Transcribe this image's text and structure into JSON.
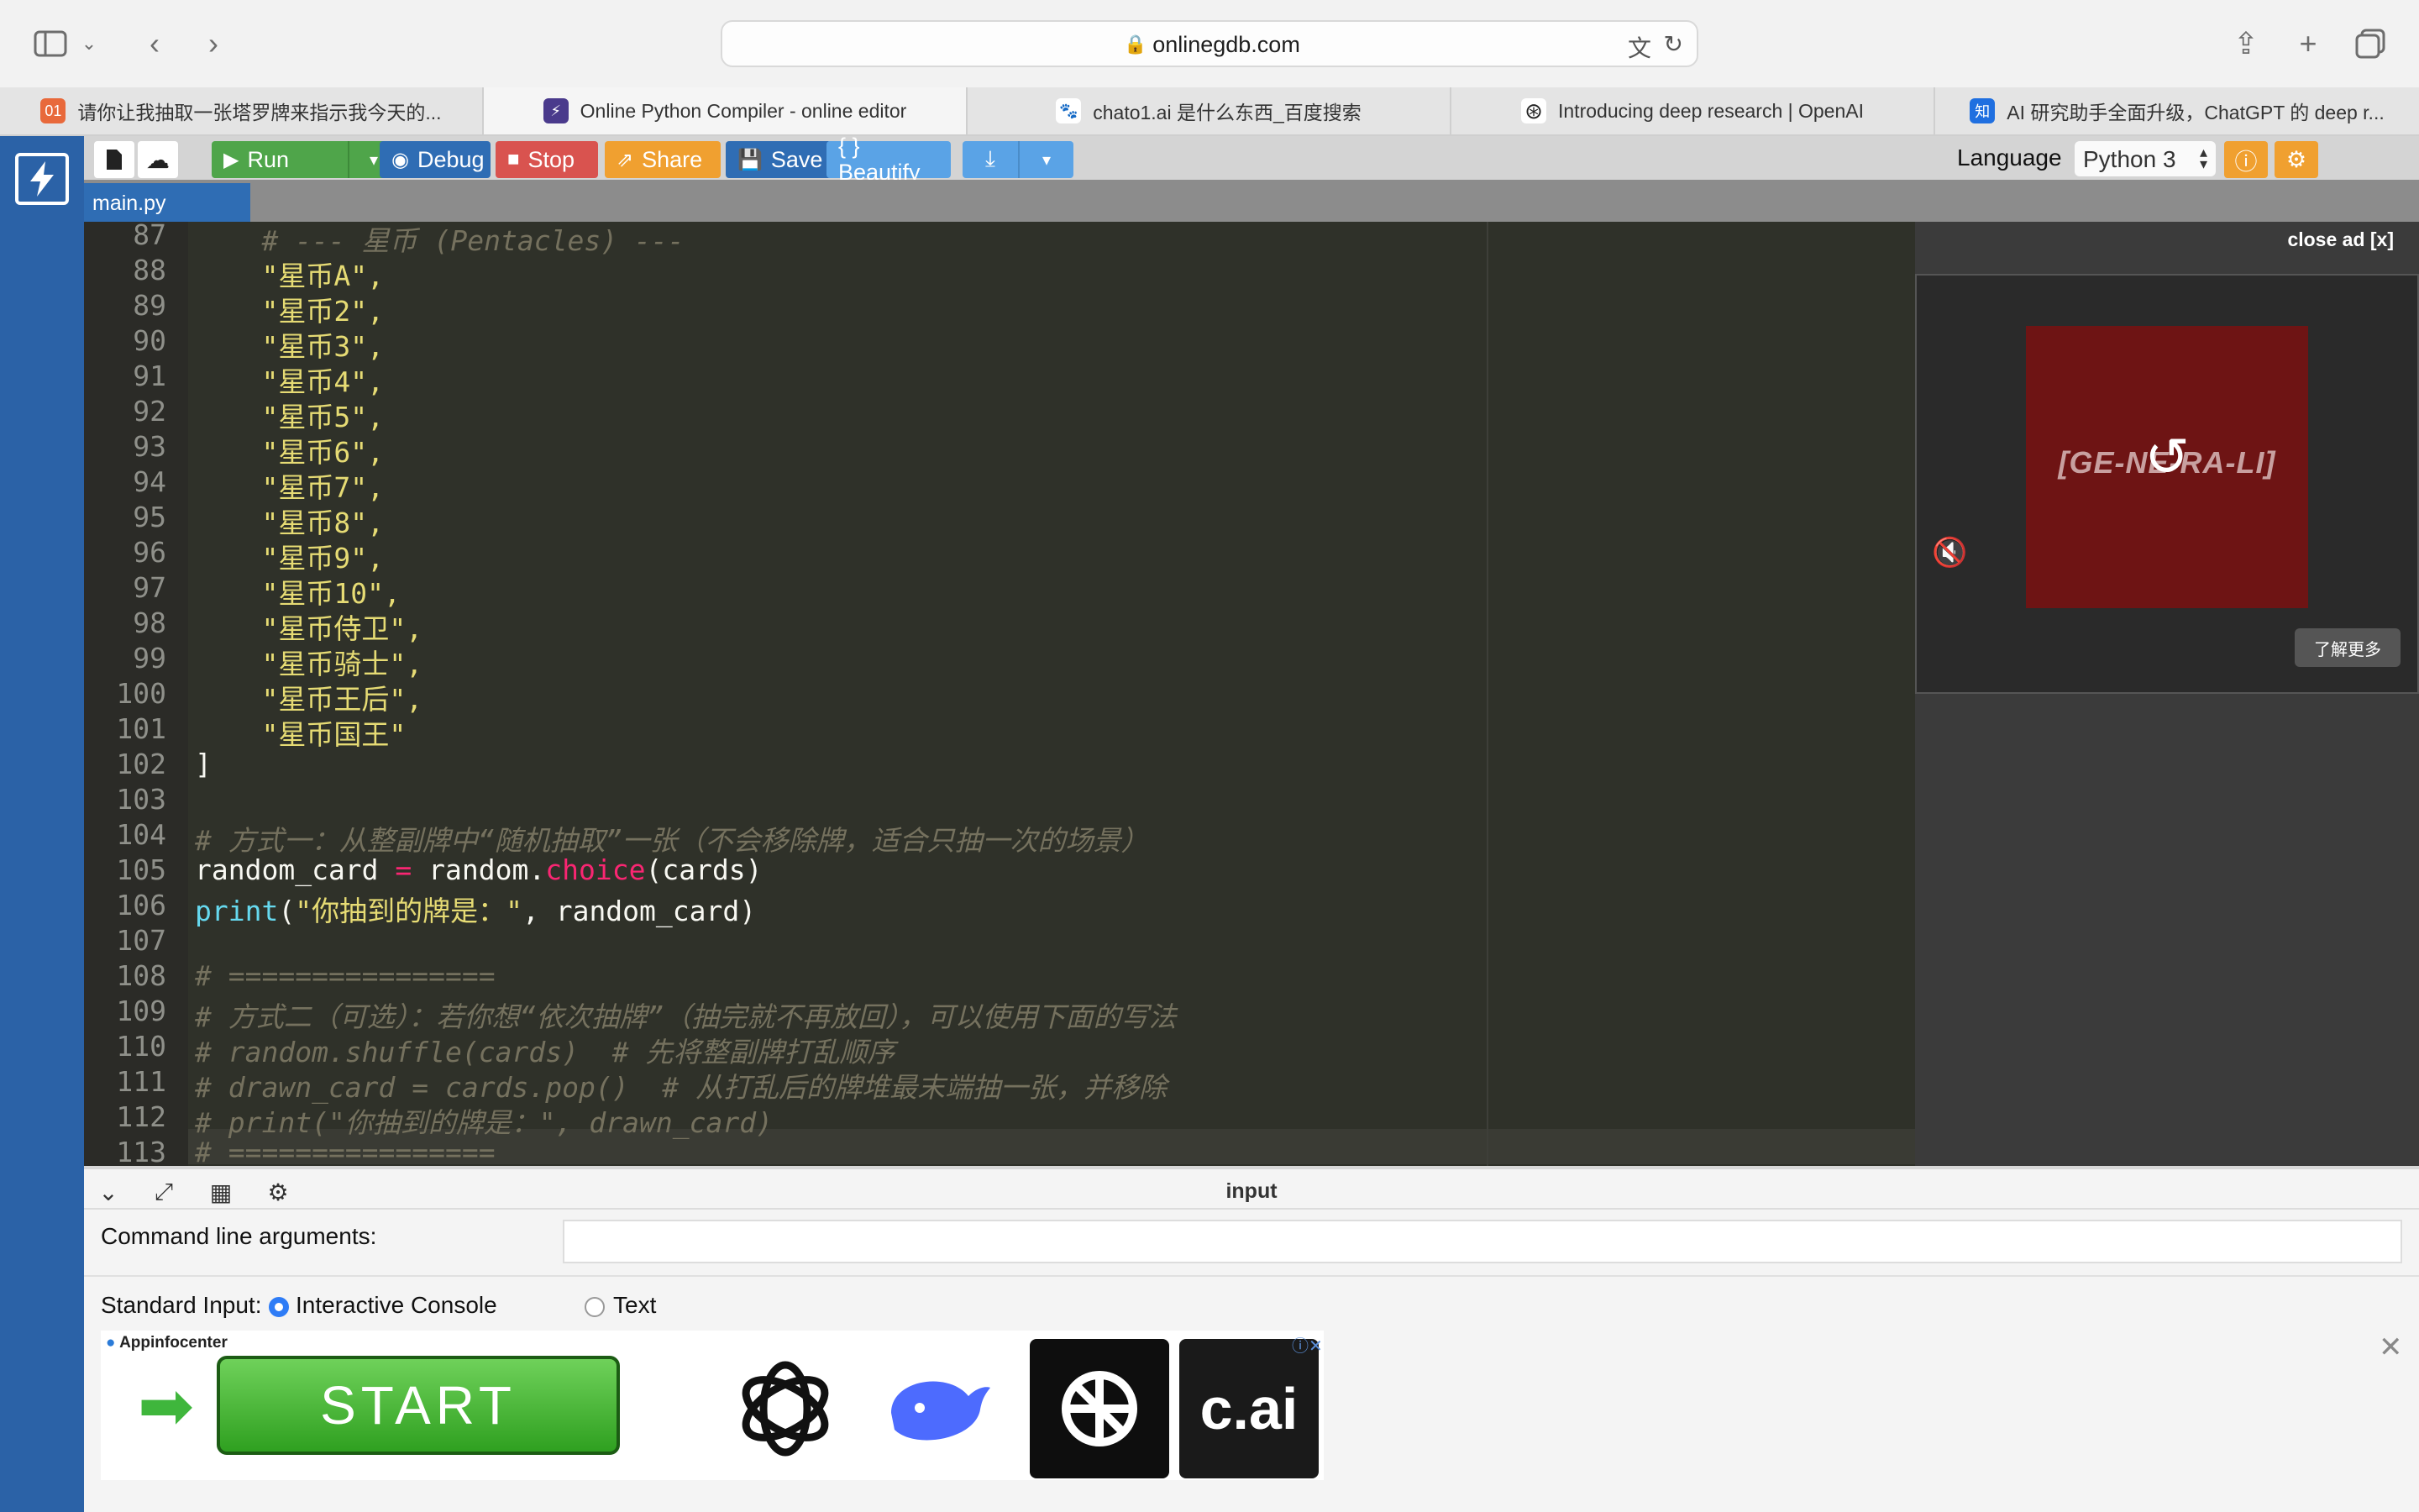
{
  "browser": {
    "address": "onlinegdb.com",
    "tabs": [
      {
        "label": "请你让我抽取一张塔罗牌来指示我今天的...",
        "favicon_text": "01",
        "favicon_color": "#e8693b"
      },
      {
        "label": "Online Python Compiler - online editor",
        "favicon_text": "⚡",
        "favicon_color": "#4a3a8c"
      },
      {
        "label": "chato1.ai 是什么东西_百度搜索",
        "favicon_text": "🐾",
        "favicon_color": "#ffffff"
      },
      {
        "label": "Introducing deep research | OpenAI",
        "favicon_text": "⊛",
        "favicon_color": "#ffffff"
      },
      {
        "label": "AI 研究助手全面升级，ChatGPT 的 deep r...",
        "favicon_text": "知",
        "favicon_color": "#1f6fe0"
      }
    ]
  },
  "toolbar": {
    "run": "Run",
    "debug": "Debug",
    "stop": "Stop",
    "share": "Share",
    "save": "Save",
    "beautify": "{ } Beautify",
    "language_label": "Language",
    "language_value": "Python 3"
  },
  "file_tab": "main.py",
  "editor": {
    "line_numbers": [
      "87",
      "88",
      "89",
      "90",
      "91",
      "92",
      "93",
      "94",
      "95",
      "96",
      "97",
      "98",
      "99",
      "100",
      "101",
      "102",
      "103",
      "104",
      "105",
      "106",
      "107",
      "108",
      "109",
      "110",
      "111",
      "112",
      "113"
    ],
    "lines": {
      "l87": "    # --- 星币 (Pentacles) ---",
      "l88": "    \"星币A\",",
      "l89": "    \"星币2\",",
      "l90": "    \"星币3\",",
      "l91": "    \"星币4\",",
      "l92": "    \"星币5\",",
      "l93": "    \"星币6\",",
      "l94": "    \"星币7\",",
      "l95": "    \"星币8\",",
      "l96": "    \"星币9\",",
      "l97": "    \"星币10\",",
      "l98": "    \"星币侍卫\",",
      "l99": "    \"星币骑士\",",
      "l100": "    \"星币王后\",",
      "l101": "    \"星币国王\"",
      "l102": "]",
      "l103": "",
      "l104": "# 方式一：从整副牌中“随机抽取”一张（不会移除牌，适合只抽一次的场景）",
      "l105_a": "random_card ",
      "l105_b": "=",
      "l105_c": " random.",
      "l105_d": "choice",
      "l105_e": "(cards)",
      "l106_a": "print",
      "l106_b": "(",
      "l106_c": "\"你抽到的牌是：\"",
      "l106_d": ", random_card)",
      "l107": "",
      "l108": "# ================",
      "l109": "# 方式二（可选）：若你想“依次抽牌”（抽完就不再放回），可以使用下面的写法",
      "l110": "# random.shuffle(cards)  # 先将整副牌打乱顺序",
      "l111": "# drawn_card = cards.pop()  # 从打乱后的牌堆最末端抽一张，并移除",
      "l112": "# print(\"你抽到的牌是：\", drawn_card)",
      "l113": "# ================"
    }
  },
  "ad_panel": {
    "close": "close ad [x]",
    "learn_more": "了解更多",
    "ad_logo_text": "[GE-NE-RA-LI]"
  },
  "io": {
    "title": "input",
    "cmd_label": "Command line arguments:",
    "stdin_label": "Standard Input:",
    "option_console": "Interactive Console",
    "option_text": "Text"
  },
  "bottom_ad": {
    "brand": "Appinfocenter",
    "start": "START",
    "app_cai": "c.ai"
  },
  "colors": {
    "run_green": "#4fa54a",
    "debug_blue": "#2f6db4",
    "stop_red": "#d9534f",
    "share_orange": "#f0a030",
    "beautify_blue": "#5aa3e6",
    "rail_blue": "#2b62a7"
  }
}
